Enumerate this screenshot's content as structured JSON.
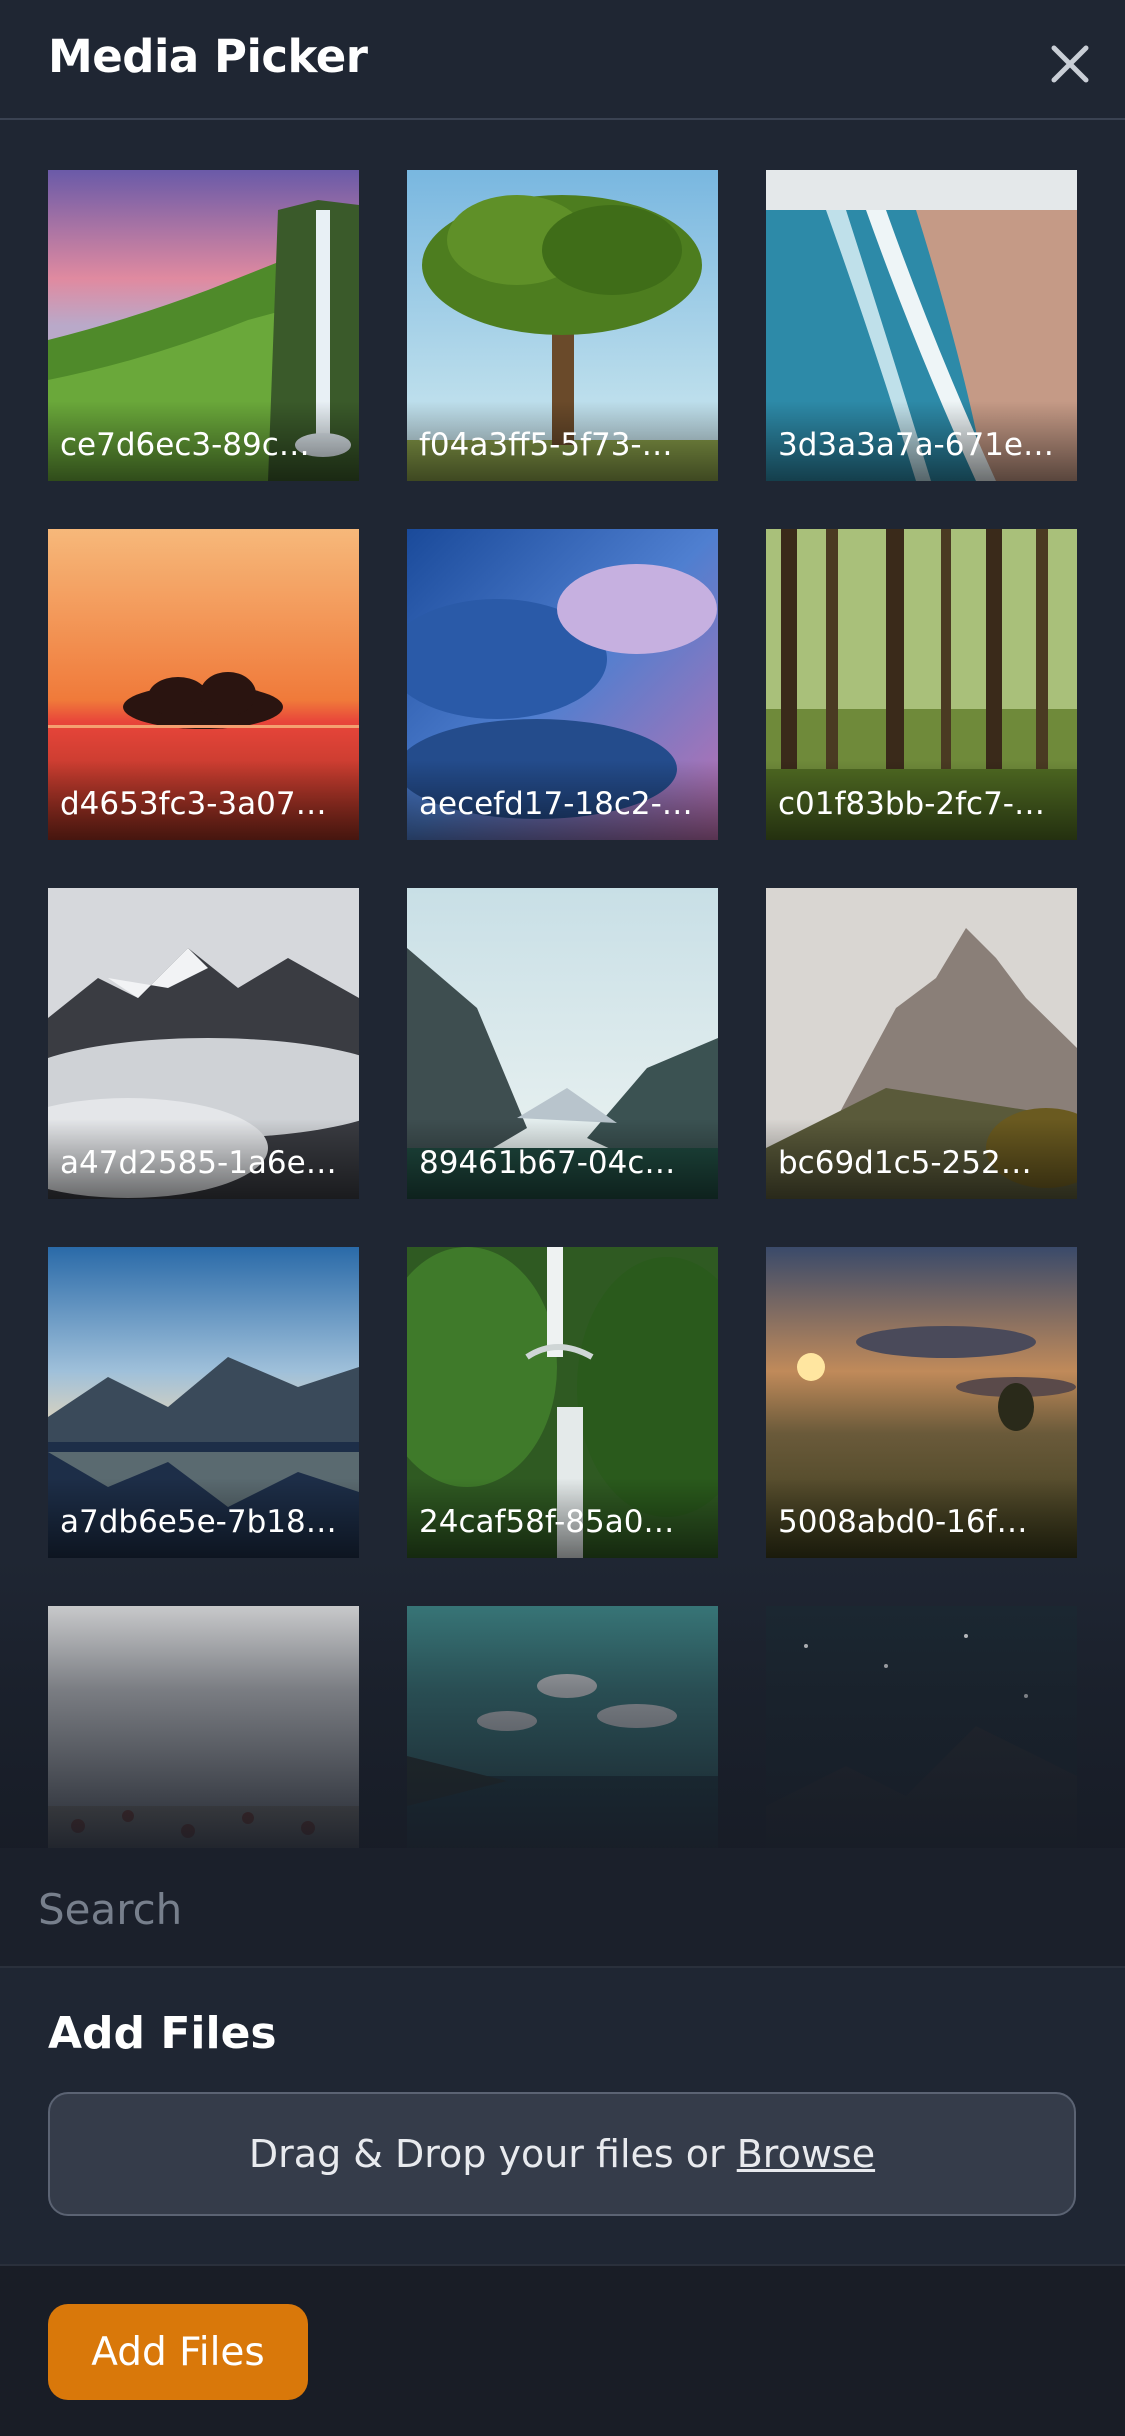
{
  "header": {
    "title": "Media Picker",
    "close_icon": "close-icon"
  },
  "media": [
    {
      "label": "ce7d6ec3-89c…",
      "scene": "waterfall-meadow"
    },
    {
      "label": "f04a3ff5-5f73-…",
      "scene": "oak-tree"
    },
    {
      "label": "3d3a3a7a-671e…",
      "scene": "beach-waves"
    },
    {
      "label": "d4653fc3-3a07…",
      "scene": "island-sunset"
    },
    {
      "label": "aecefd17-18c2-…",
      "scene": "storm-clouds"
    },
    {
      "label": "c01f83bb-2fc7-…",
      "scene": "forest"
    },
    {
      "label": "a47d2585-1a6e…",
      "scene": "misty-mountains"
    },
    {
      "label": "89461b67-04c…",
      "scene": "valley-lake"
    },
    {
      "label": "bc69d1c5-252…",
      "scene": "rocky-peaks"
    },
    {
      "label": "a7db6e5e-7b18…",
      "scene": "mountain-lake"
    },
    {
      "label": "24caf58f-85a0…",
      "scene": "bridge-waterfall"
    },
    {
      "label": "5008abd0-16f…",
      "scene": "sunrise-meadow"
    },
    {
      "label": "",
      "scene": "foggy-flowers"
    },
    {
      "label": "",
      "scene": "river-bay"
    },
    {
      "label": "",
      "scene": "night-sky"
    }
  ],
  "search": {
    "placeholder": "Search"
  },
  "add_files": {
    "title": "Add Files",
    "dropzone_text": "Drag & Drop your files or ",
    "browse_link": "Browse"
  },
  "footer": {
    "button_label": "Add Files",
    "button_color": "#d9780a"
  }
}
